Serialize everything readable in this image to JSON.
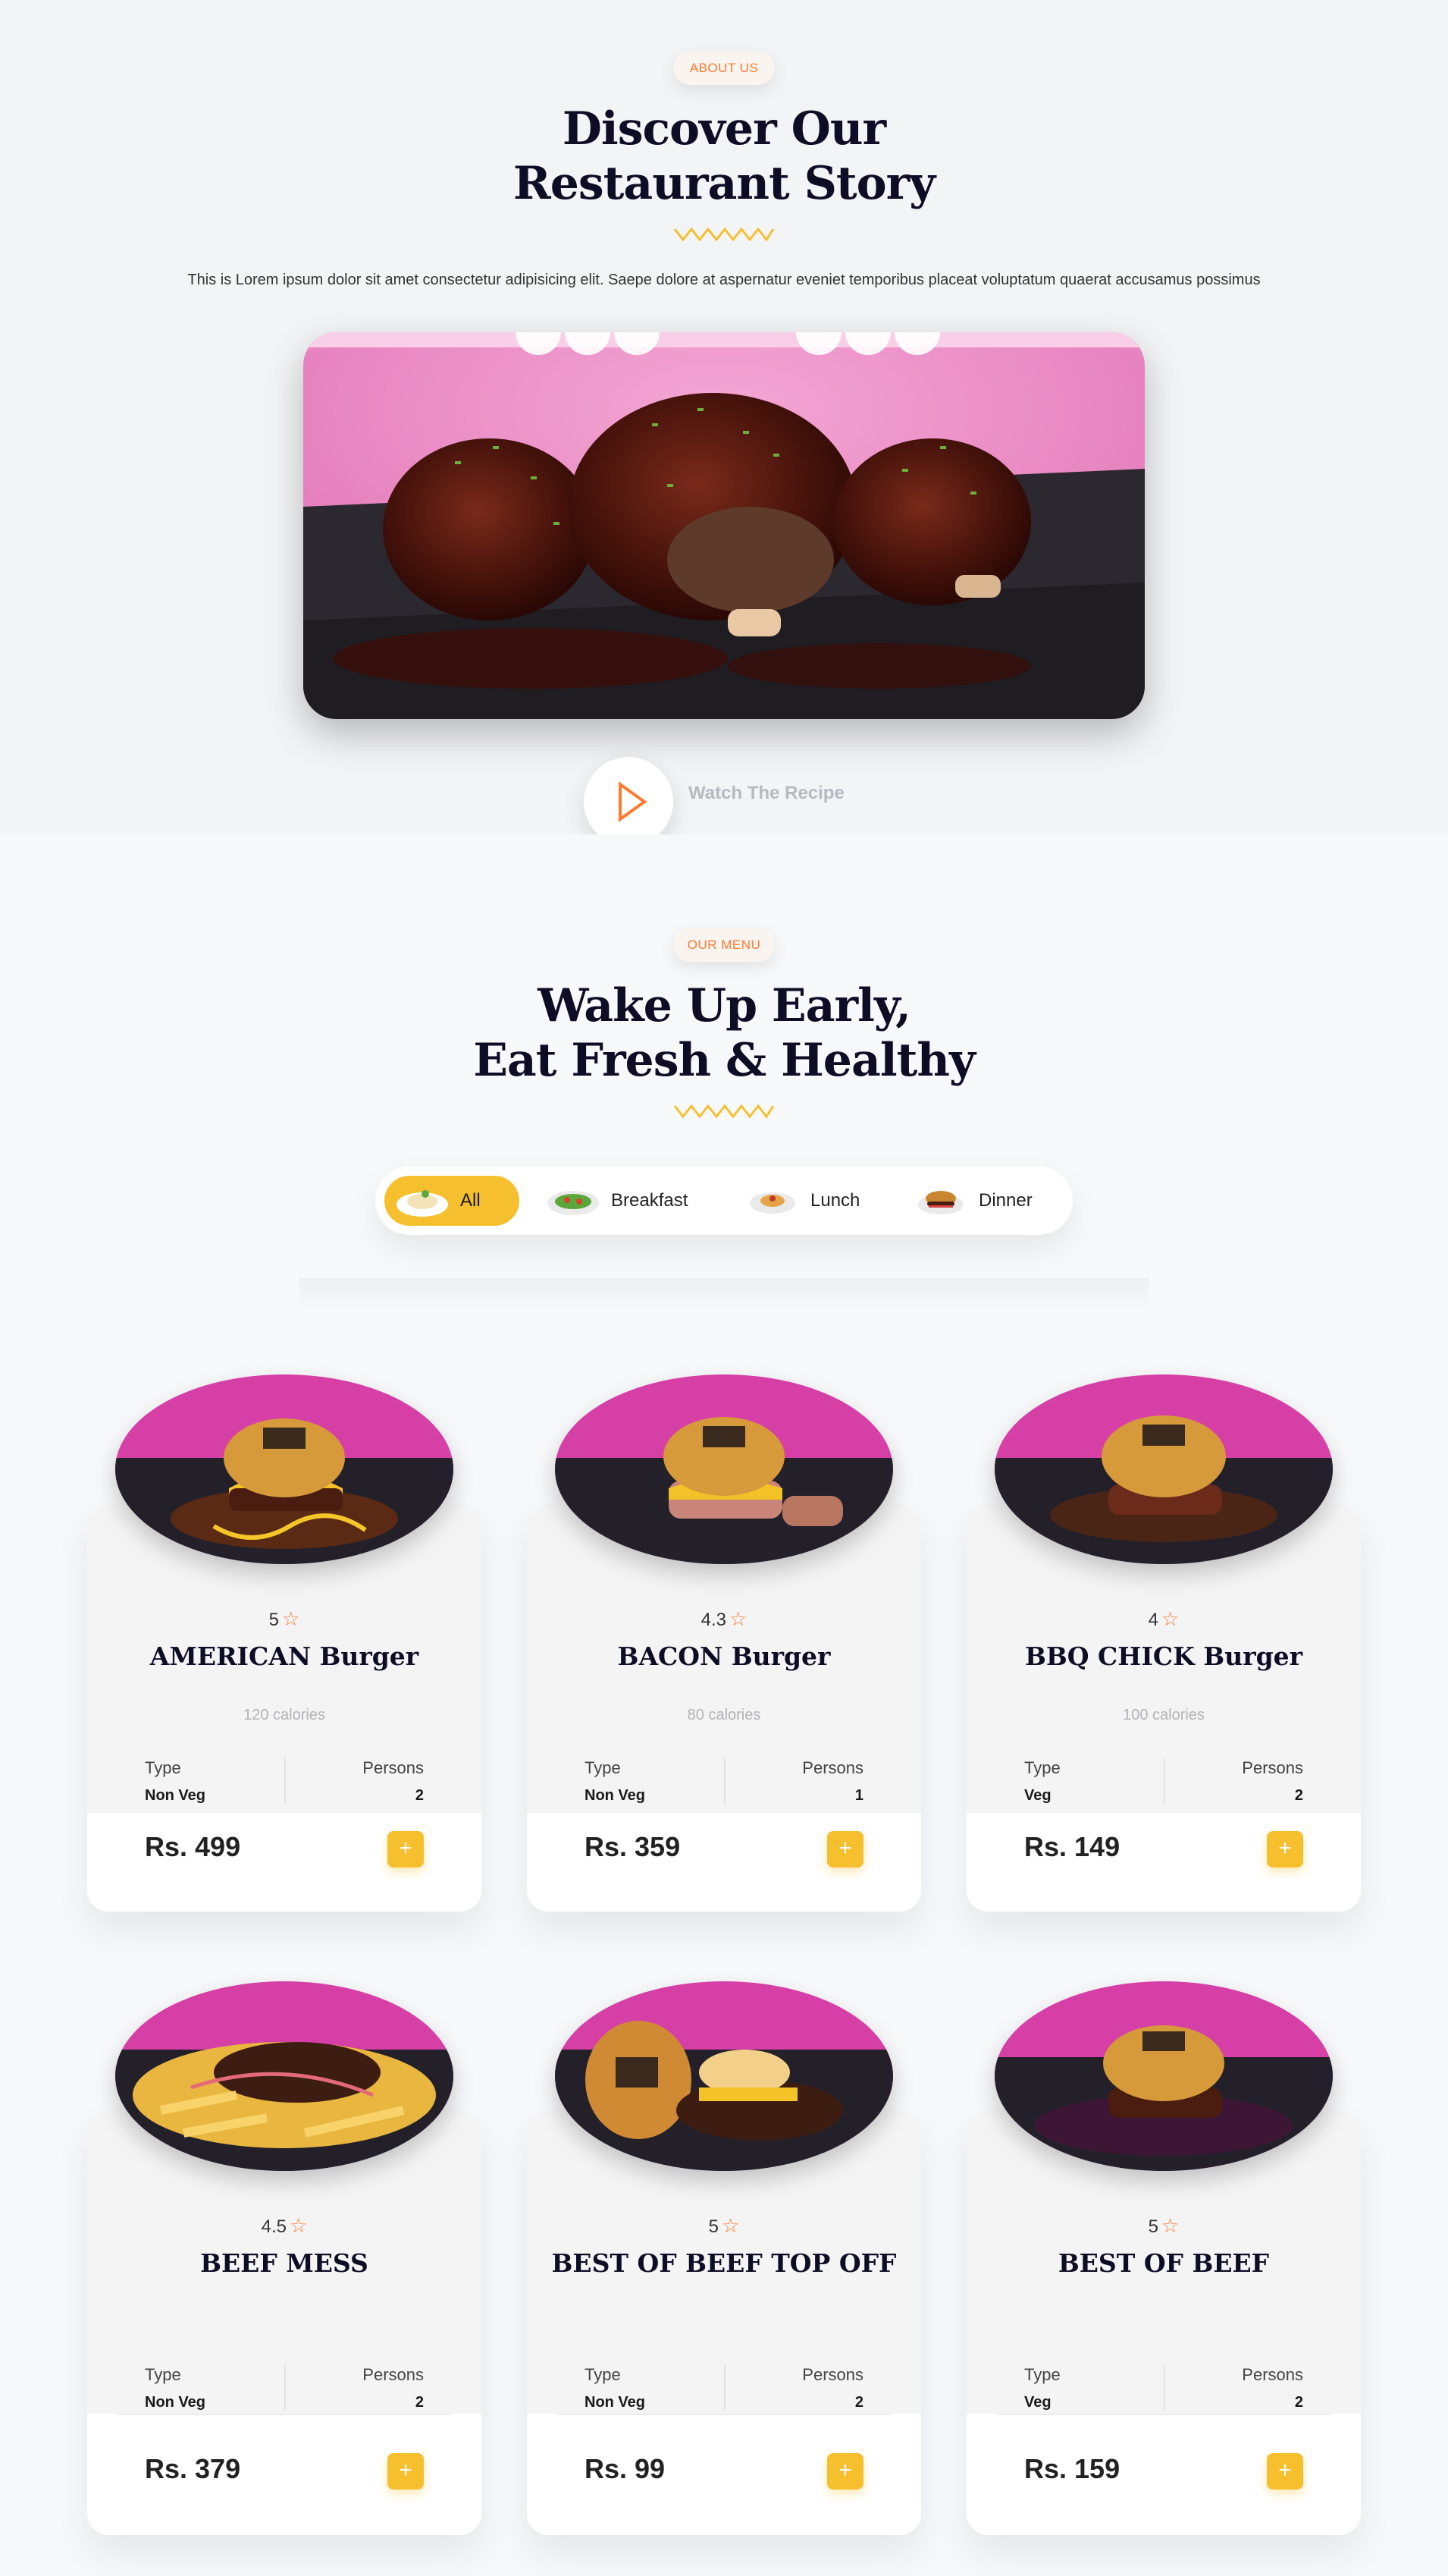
{
  "about": {
    "badge": "ABOUT US",
    "title_line1": "Discover Our",
    "title_line2": "Restaurant Story",
    "text": "This is Lorem ipsum dolor sit amet consectetur adipisicing elit. Saepe dolore at aspernatur eveniet temporibus placeat voluptatum quaerat accusamus possimus",
    "watch_label": "Watch The Recipe"
  },
  "menu": {
    "badge": "OUR MENU",
    "title_line1": "Wake Up Early,",
    "title_line2": "Eat Fresh & Healthy",
    "tabs": [
      {
        "label": "All",
        "icon": "rice-plate-icon",
        "active": true
      },
      {
        "label": "Breakfast",
        "icon": "salad-plate-icon",
        "active": false
      },
      {
        "label": "Lunch",
        "icon": "noodle-plate-icon",
        "active": false
      },
      {
        "label": "Dinner",
        "icon": "burger-plate-icon",
        "active": false
      }
    ],
    "type_label": "Type",
    "persons_label": "Persons",
    "items": [
      {
        "rating": "5",
        "name": "AMERICAN Burger",
        "calories": "120 calories",
        "type": "Non Veg",
        "persons": "2",
        "price": "Rs. 499"
      },
      {
        "rating": "4.3",
        "name": "BACON Burger",
        "calories": "80 calories",
        "type": "Non Veg",
        "persons": "1",
        "price": "Rs. 359"
      },
      {
        "rating": "4",
        "name": "BBQ CHICK Burger",
        "calories": "100 calories",
        "type": "Veg",
        "persons": "2",
        "price": "Rs. 149"
      },
      {
        "rating": "4.5",
        "name": "BEEF MESS",
        "calories": "",
        "type": "Non Veg",
        "persons": "2",
        "price": "Rs. 379"
      },
      {
        "rating": "5",
        "name": "BEST OF BEEF TOP OFF",
        "calories": "",
        "type": "Non Veg",
        "persons": "2",
        "price": "Rs. 99"
      },
      {
        "rating": "5",
        "name": "BEST OF BEEF",
        "calories": "",
        "type": "Veg",
        "persons": "2",
        "price": "Rs. 159"
      }
    ],
    "add_symbol": "+"
  },
  "colors": {
    "accent": "#f6bf2e",
    "orange": "#ff7a2f",
    "heading": "#0d0d25"
  }
}
